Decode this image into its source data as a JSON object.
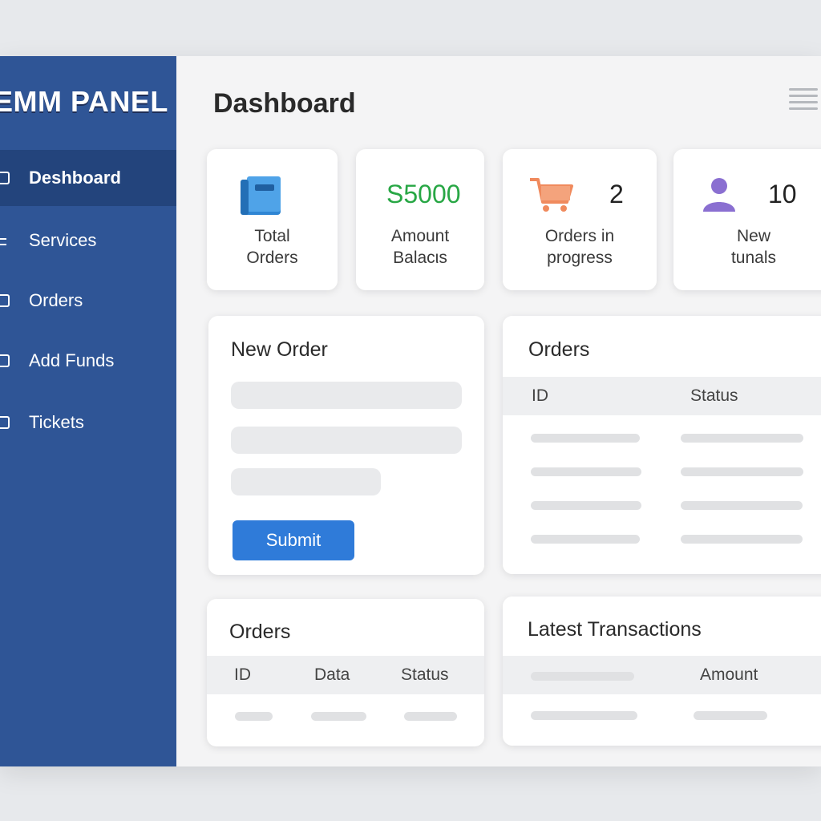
{
  "sidebar": {
    "brand": "EMM PANEL",
    "items": [
      {
        "label": "Deshboard",
        "icon": "dashboard-icon"
      },
      {
        "label": "Services",
        "icon": "services-icon"
      },
      {
        "label": "Orders",
        "icon": "orders-icon"
      },
      {
        "label": "Add Funds",
        "icon": "add-funds-icon"
      },
      {
        "label": "Tickets",
        "icon": "tickets-icon"
      }
    ]
  },
  "header": {
    "title": "Dashboard",
    "menu_icon": "hamburger-menu-icon"
  },
  "stats": [
    {
      "label": "Total\nOrders",
      "value": "",
      "icon": "folder-icon"
    },
    {
      "label": "Amount\nBalacιs",
      "value": "S5000"
    },
    {
      "label": "Orders in\nprogress",
      "value": "2",
      "icon": "cart-icon"
    },
    {
      "label": "New\ntunals",
      "value": "10",
      "icon": "user-icon"
    }
  ],
  "new_order": {
    "title": "New Order",
    "submit_label": "Submit"
  },
  "orders_table": {
    "title": "Orders",
    "columns": [
      "ID",
      "Status"
    ]
  },
  "orders_small": {
    "title": "Orders",
    "columns": [
      "ID",
      "Data",
      "Status"
    ]
  },
  "transactions": {
    "title": "Latest Transactions",
    "columns": [
      "",
      "Amount"
    ]
  },
  "colors": {
    "sidebar": "#2f5596",
    "sidebar_active": "#23447c",
    "accent": "#2f7bd9",
    "money": "#28a745",
    "cart": "#f08a5d",
    "user": "#8a6fd1"
  }
}
